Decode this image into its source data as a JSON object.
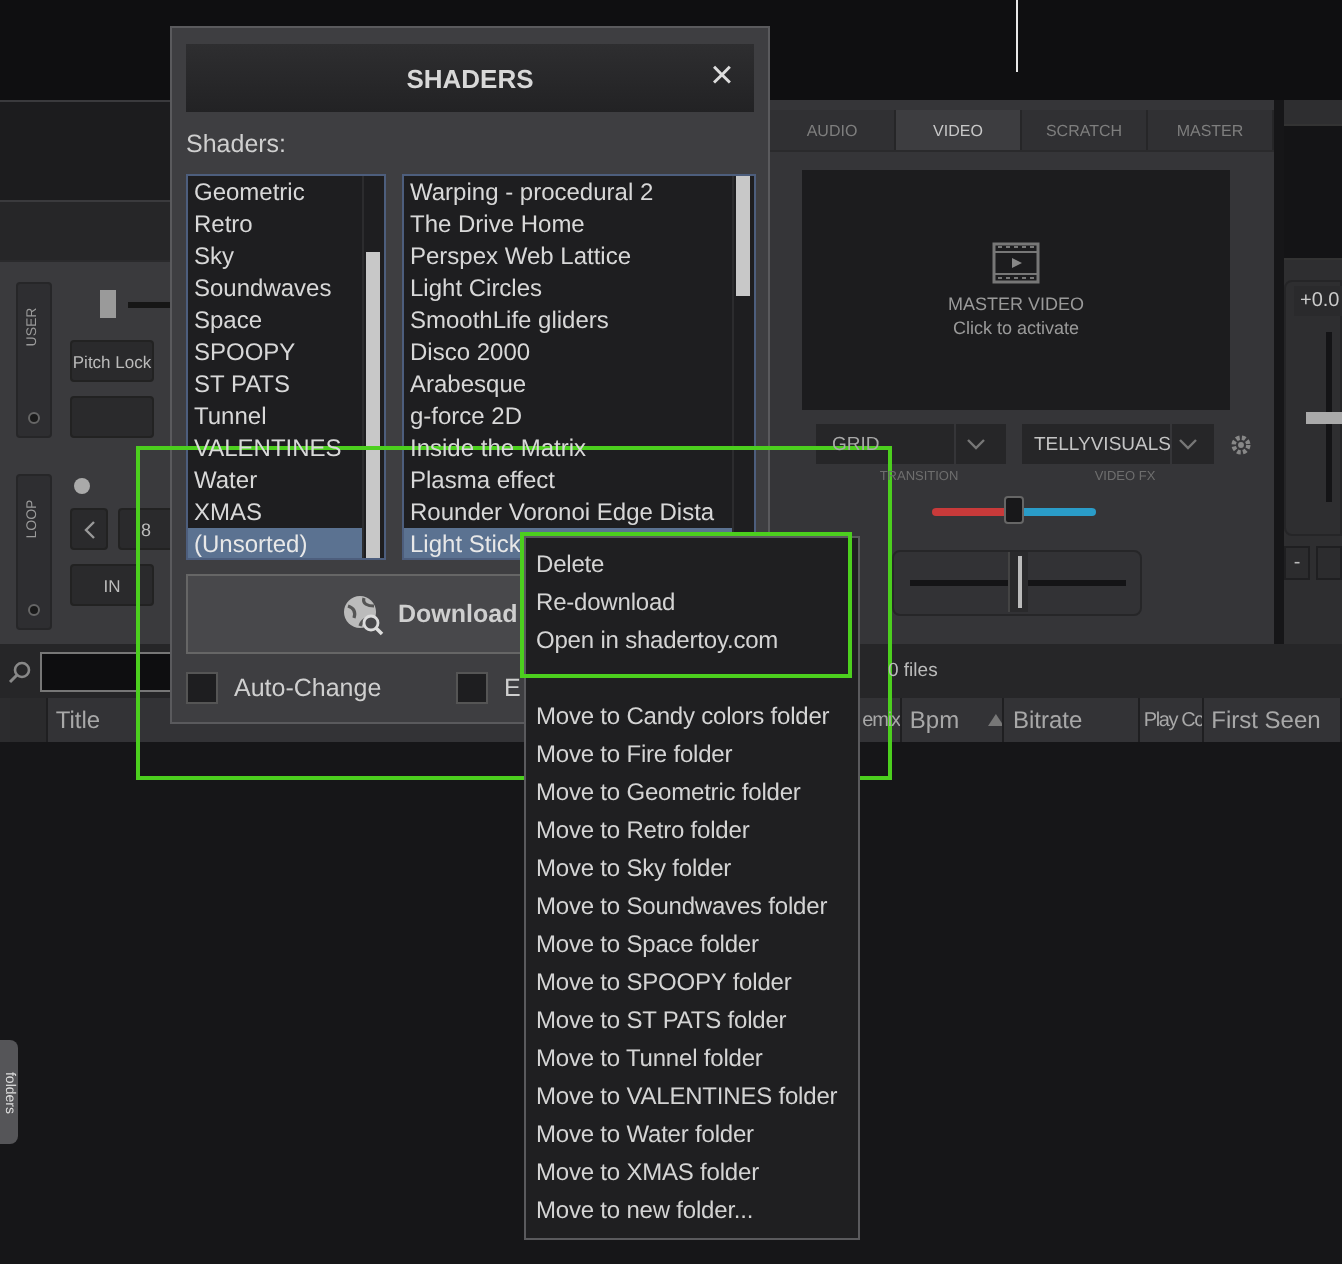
{
  "deck": {
    "user_label": "USER",
    "pitch_lock": "Pitch Lock",
    "loop_label": "LOOP",
    "loop_size": "8",
    "loop_in": "IN"
  },
  "video_panel": {
    "tabs": [
      {
        "label": "AUDIO",
        "selected": false
      },
      {
        "label": "VIDEO",
        "selected": true
      },
      {
        "label": "SCRATCH",
        "selected": false
      },
      {
        "label": "MASTER",
        "selected": false
      }
    ],
    "screen_title": "MASTER VIDEO",
    "screen_hint": "Click to activate",
    "transition": {
      "value": "GRID",
      "label": "TRANSITION"
    },
    "video_fx": {
      "value": "TELLYVISUALS",
      "label": "VIDEO FX"
    },
    "crossfader": {
      "level": 0.5
    },
    "fader": {
      "level": 0.5
    }
  },
  "pitch": {
    "reading": "+0.0",
    "level": 0.5,
    "minus_button": "-"
  },
  "browser": {
    "file_count": "0 files",
    "columns": [
      {
        "label": "Title",
        "sorted": false
      },
      {
        "label": "emix",
        "sorted": false
      },
      {
        "label": "Bpm",
        "sorted": true
      },
      {
        "label": "Bitrate",
        "sorted": false
      },
      {
        "label": "Play Cc",
        "sorted": false
      },
      {
        "label": "First Seen",
        "sorted": false
      }
    ]
  },
  "side_tab": "folders",
  "dialog": {
    "title": "SHADERS",
    "close": "×",
    "list_label": "Shaders:",
    "folders": [
      {
        "label": "Geometric",
        "selected": false
      },
      {
        "label": "Retro",
        "selected": false
      },
      {
        "label": "Sky",
        "selected": false
      },
      {
        "label": "Soundwaves",
        "selected": false
      },
      {
        "label": "Space",
        "selected": false
      },
      {
        "label": "SPOOPY",
        "selected": false
      },
      {
        "label": "ST PATS",
        "selected": false
      },
      {
        "label": "Tunnel",
        "selected": false
      },
      {
        "label": "VALENTINES",
        "selected": false
      },
      {
        "label": "Water",
        "selected": false
      },
      {
        "label": "XMAS",
        "selected": false
      },
      {
        "label": "(Unsorted)",
        "selected": true
      }
    ],
    "shaders": [
      {
        "label": "Warping - procedural 2",
        "selected": false
      },
      {
        "label": "The Drive Home",
        "selected": false
      },
      {
        "label": "Perspex Web Lattice",
        "selected": false
      },
      {
        "label": "Light Circles",
        "selected": false
      },
      {
        "label": "SmoothLife gliders",
        "selected": false
      },
      {
        "label": "Disco 2000",
        "selected": false
      },
      {
        "label": "Arabesque",
        "selected": false
      },
      {
        "label": "g-force 2D",
        "selected": false
      },
      {
        "label": "Inside the Matrix",
        "selected": false
      },
      {
        "label": "Plasma effect",
        "selected": false
      },
      {
        "label": "Rounder Voronoi Edge Dista",
        "selected": false
      },
      {
        "label": "Light Stick",
        "selected": true
      }
    ],
    "download_button": "Download",
    "options": [
      {
        "label": "Auto-Change",
        "checked": false
      },
      {
        "label": "E",
        "checked": false
      }
    ]
  },
  "context_menu": {
    "groups": [
      [
        "Delete",
        "Re-download",
        "Open in shadertoy.com"
      ],
      [
        "Move to Candy colors folder",
        "Move to Fire folder",
        "Move to Geometric folder",
        "Move to Retro folder",
        "Move to Sky folder",
        "Move to Soundwaves folder",
        "Move to Space folder",
        "Move to SPOOPY folder",
        "Move to ST PATS folder",
        "Move to Tunnel folder",
        "Move to VALENTINES folder",
        "Move to Water folder",
        "Move to XMAS folder",
        "Move to new folder..."
      ]
    ]
  },
  "highlights": [
    {
      "color": "#4ccf1e"
    },
    {
      "color": "#4ccf1e"
    }
  ]
}
